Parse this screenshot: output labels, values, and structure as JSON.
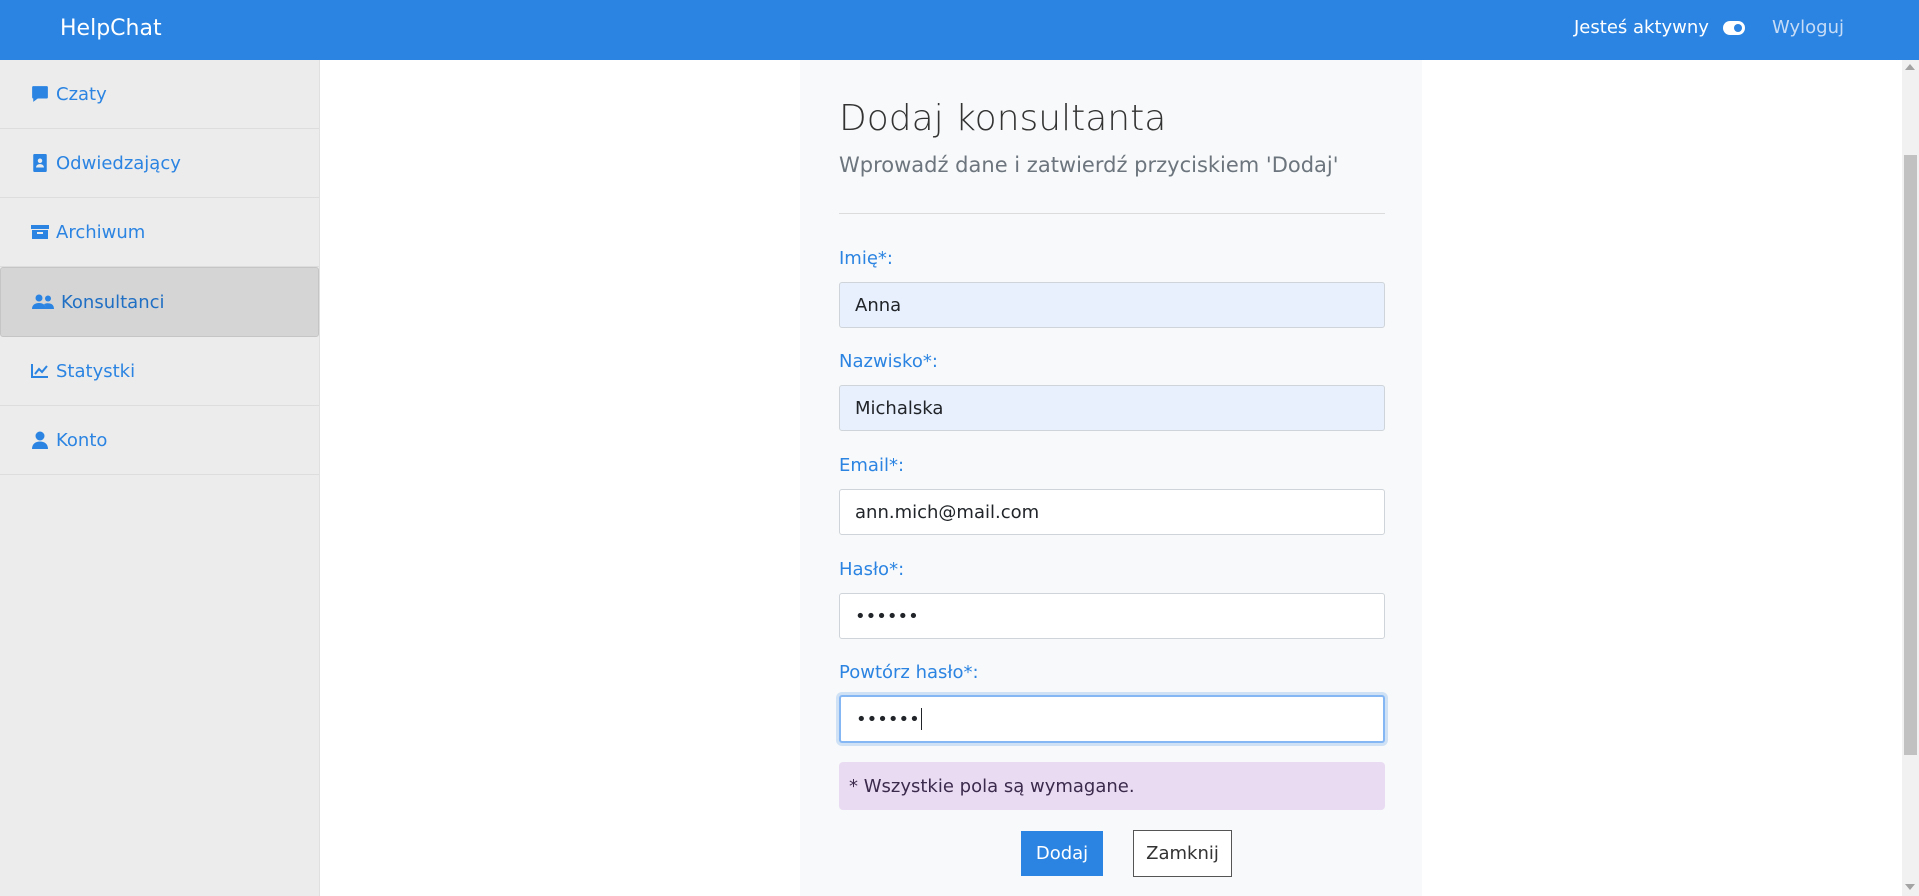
{
  "topbar": {
    "brand": "HelpChat",
    "status_text": "Jesteś aktywny",
    "logout": "Wyloguj"
  },
  "sidebar": {
    "items": [
      {
        "label": "Czaty",
        "icon": "comment-icon"
      },
      {
        "label": "Odwiedzający",
        "icon": "address-book-icon"
      },
      {
        "label": "Archiwum",
        "icon": "archive-icon"
      },
      {
        "label": "Konsultanci",
        "icon": "users-icon",
        "active": true
      },
      {
        "label": "Statystki",
        "icon": "chart-line-icon"
      },
      {
        "label": "Konto",
        "icon": "user-icon"
      }
    ]
  },
  "form": {
    "title": "Dodaj konsultanta",
    "subtitle": "Wprowadź dane i zatwierdź przyciskiem 'Dodaj'",
    "fields": [
      {
        "label": "Imię*:",
        "value": "Anna"
      },
      {
        "label": "Nazwisko*:",
        "value": "Michalska"
      },
      {
        "label": "Email*:",
        "value": "ann.mich@mail.com"
      },
      {
        "label": "Hasło*:",
        "value": "••••••"
      },
      {
        "label": "Powtórz hasło*:",
        "value": "••••••"
      }
    ],
    "note": "* Wszystkie pola są wymagane.",
    "submit": "Dodaj",
    "close": "Zamknij"
  },
  "colors": {
    "accent": "#2b84e2",
    "note_bg": "#e9dcf2",
    "autofill_bg": "#e8f0fe"
  }
}
